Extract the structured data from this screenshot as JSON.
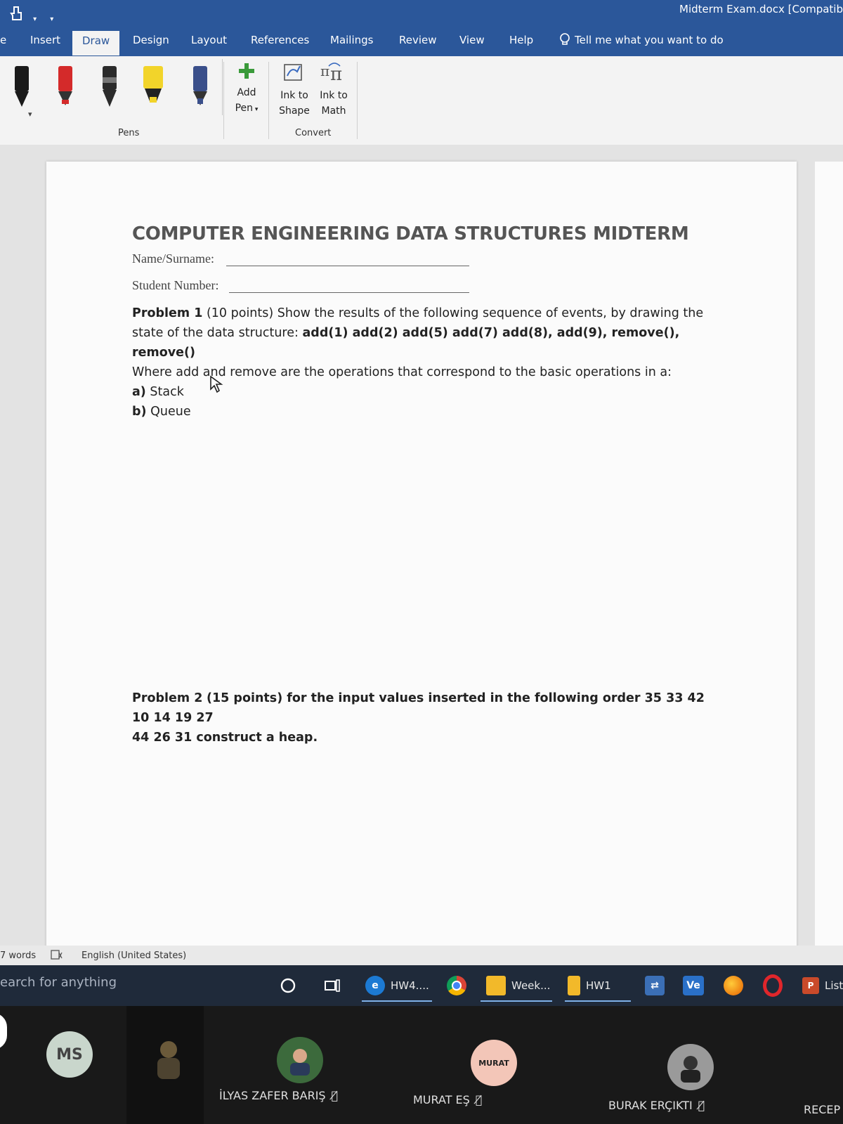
{
  "titlebar": {
    "doc_title": "Midterm Exam.docx [Compatib"
  },
  "ribbon_tabs": [
    "e",
    "Insert",
    "Draw",
    "Design",
    "Layout",
    "References",
    "Mailings",
    "Review",
    "View",
    "Help"
  ],
  "tell_me": "Tell me what you want to do",
  "draw_ribbon": {
    "pens_group_label": "Pens",
    "add_pen_line1": "Add",
    "add_pen_line2": "Pen",
    "ink_to_shape_line1": "Ink to",
    "ink_to_shape_line2": "Shape",
    "ink_to_math_line1": "Ink to",
    "ink_to_math_line2": "Math",
    "convert_group_label": "Convert",
    "pen_colors": [
      "#1a1a1a",
      "#d42a2a",
      "#2b2b2b",
      "#f2d42a",
      "#3a4f8a"
    ]
  },
  "document": {
    "title": "COMPUTER ENGINEERING DATA STRUCTURES MIDTERM",
    "name_label": "Name/Surname:",
    "student_number_label": "Student Number:",
    "problem1_title": "Problem 1",
    "problem1_points": "(10 points) Show the results of the following sequence of events, by drawing the",
    "problem1_line2_pre": "state of the data structure:",
    "problem1_ops": "add(1) add(2) add(5) add(7) add(8), add(9), remove(), remove()",
    "problem1_line3": "Where add and remove are the operations that correspond to the basic operations in a:",
    "problem1_a_label": "a)",
    "problem1_a": "Stack",
    "problem1_b_label": "b)",
    "problem1_b": "Queue",
    "problem2_title": "Problem 2",
    "problem2_line1": "(15 points) for the input values inserted in the following order 35 33 42 10 14 19 27",
    "problem2_line2": "44 26 31 construct a heap."
  },
  "statusbar": {
    "words": "7 words",
    "language": "English (United States)"
  },
  "taskbar": {
    "search_placeholder": "earch for anything",
    "apps": [
      {
        "label": "HW4...."
      },
      {
        "label": "Week..."
      },
      {
        "label": "HW1"
      },
      {
        "label": "List"
      }
    ]
  },
  "meeting": {
    "participants": [
      {
        "initials": "MS"
      },
      {
        "name": "İLYAS ZAFER BARIŞ"
      },
      {
        "initials": "MURAT",
        "name": "MURAT EŞ"
      },
      {
        "name": "BURAK ERÇIKTI"
      },
      {
        "name": "RECEP"
      }
    ]
  }
}
